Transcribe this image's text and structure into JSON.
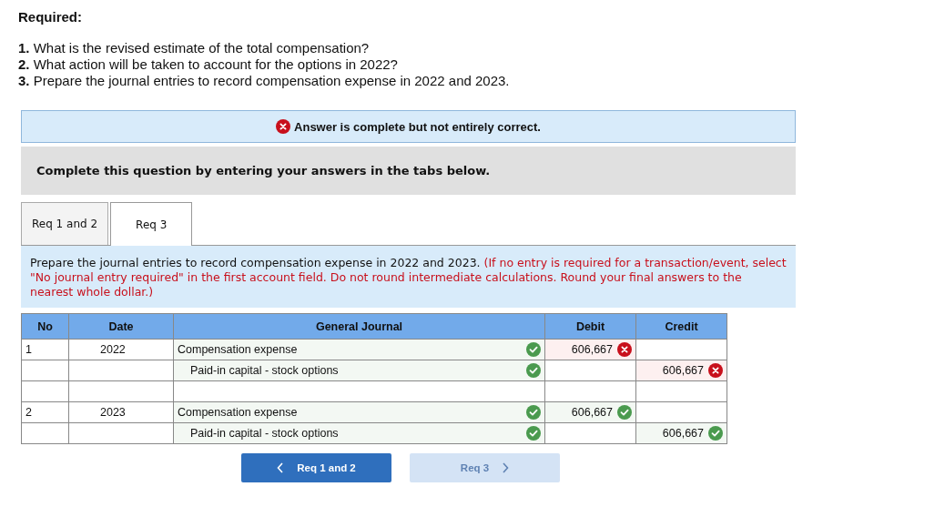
{
  "required": {
    "title": "Required:",
    "items": [
      "**1.** What is the revised estimate of the total compensation?",
      "**2.** What action will be taken to account for the options in 2022?",
      "**3.** Prepare the journal entries to record compensation expense in 2022 and 2023."
    ]
  },
  "banner": {
    "correct": false,
    "text": "Answer is complete but not entirely correct."
  },
  "prompt": "Complete this question by entering your answers in the tabs below.",
  "tabs": [
    {
      "label": "Req 1 and 2",
      "selected": false
    },
    {
      "label": "Req 3",
      "selected": true
    }
  ],
  "instruction": {
    "text": "Prepare the journal entries to record compensation expense in 2022 and 2023.",
    "note": "(If no entry is required for a transaction/event, select \"No journal entry required\" in the first account field. Do not round intermediate calculations. Round your final answers to the nearest whole dollar.)"
  },
  "table": {
    "columns": [
      "No",
      "Date",
      "General Journal",
      "Debit",
      "Credit"
    ],
    "rows": [
      {
        "kind": "debit",
        "no": "1",
        "date": "2022",
        "account": "Compensation expense",
        "account_correct": true,
        "debit": "606,667",
        "debit_correct": false
      },
      {
        "kind": "credit",
        "account": "Paid-in capital - stock options",
        "account_correct": true,
        "credit": "606,667",
        "credit_correct": false
      },
      {
        "kind": "blank"
      },
      {
        "kind": "debit",
        "no": "2",
        "date": "2023",
        "account": "Compensation expense",
        "account_correct": true,
        "debit": "606,667",
        "debit_correct": true
      },
      {
        "kind": "credit",
        "account": "Paid-in capital - stock options",
        "account_correct": true,
        "credit": "606,667",
        "credit_correct": true
      }
    ]
  },
  "nav": [
    {
      "label": "Req 1 and 2",
      "kind": "prev",
      "disabled": false
    },
    {
      "label": "Req 3",
      "kind": "next",
      "disabled": true
    }
  ]
}
